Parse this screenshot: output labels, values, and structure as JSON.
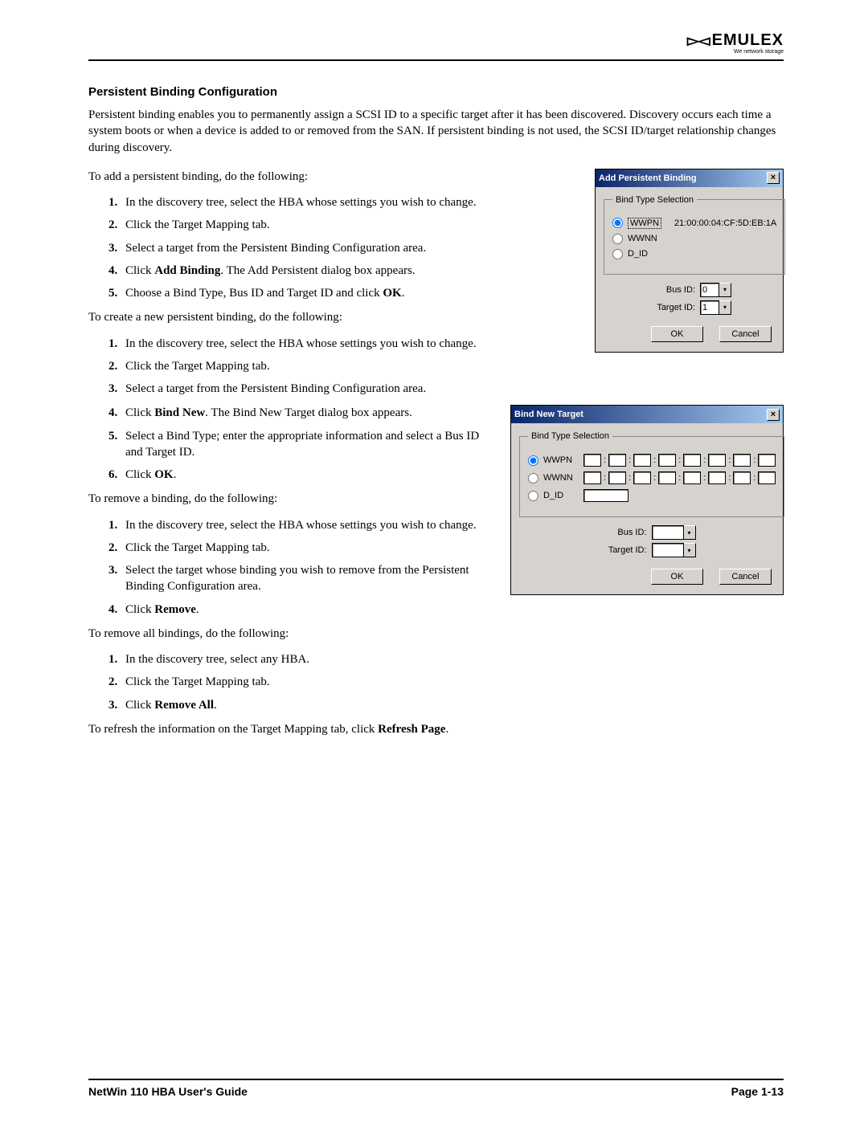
{
  "brand": {
    "name": "EMULEX",
    "tagline": "We network storage"
  },
  "section_title": "Persistent Binding Configuration",
  "intro": "Persistent binding enables you to permanently assign a SCSI ID to a specific target after it has been discovered. Discovery occurs each time a system boots or when a device is added to or removed from the SAN. If persistent binding is not used, the SCSI ID/target relationship changes during discovery.",
  "add_lead": "To add a persistent binding, do the following:",
  "add": {
    "s1": "In the discovery tree, select the HBA whose settings you wish to change.",
    "s2": "Click the Target Mapping tab.",
    "s3": "Select a target from the Persistent Binding Configuration area.",
    "s4a": "Click ",
    "s4b": "Add Binding",
    "s4c": ". The Add Persistent dialog box appears.",
    "s5a": "Choose a Bind Type, Bus ID and Target ID and click ",
    "s5b": "OK",
    "s5c": "."
  },
  "create_lead": "To create a new persistent binding, do the following:",
  "create": {
    "s1": "In the discovery tree, select the HBA whose settings you wish to change.",
    "s2": "Click the Target Mapping tab.",
    "s3": "Select a target from the Persistent Binding Configuration area.",
    "s4a": "Click ",
    "s4b": "Bind New",
    "s4c": ". The Bind New Target dialog box appears.",
    "s5": "Select a Bind Type; enter the appropriate information and select a Bus ID and Target ID.",
    "s6a": "Click ",
    "s6b": "OK",
    "s6c": "."
  },
  "remove_lead": "To remove a binding, do the following:",
  "remove": {
    "s1": "In the discovery tree, select the HBA whose settings you wish to change.",
    "s2": "Click the Target Mapping tab.",
    "s3": "Select the target whose binding you wish to remove from the Persistent Binding Configuration area.",
    "s4a": "Click ",
    "s4b": "Remove",
    "s4c": "."
  },
  "removeall_lead": "To remove all bindings, do the following:",
  "removeall": {
    "s1": "In the discovery tree, select any HBA.",
    "s2": "Click the Target Mapping tab.",
    "s3a": "Click ",
    "s3b": "Remove All",
    "s3c": "."
  },
  "refresh_a": "To refresh the information on the Target Mapping tab, click ",
  "refresh_b": "Refresh Page",
  "refresh_c": ".",
  "dlg1": {
    "title": "Add Persistent Binding",
    "legend": "Bind Type Selection",
    "opt_wwpn": "WWPN",
    "opt_wwnn": "WWNN",
    "opt_did": "D_ID",
    "wwpn_value": "21:00:00:04:CF:5D:EB:1A",
    "bus_label": "Bus ID:",
    "bus_value": "0",
    "target_label": "Target ID:",
    "target_value": "1",
    "ok": "OK",
    "cancel": "Cancel"
  },
  "dlg2": {
    "title": "Bind New Target",
    "legend": "Bind Type Selection",
    "opt_wwpn": "WWPN",
    "opt_wwnn": "WWNN",
    "opt_did": "D_ID",
    "bus_label": "Bus ID:",
    "target_label": "Target ID:",
    "ok": "OK",
    "cancel": "Cancel"
  },
  "footer": {
    "left": "NetWin 110 HBA User's Guide",
    "right": "Page 1-13"
  }
}
